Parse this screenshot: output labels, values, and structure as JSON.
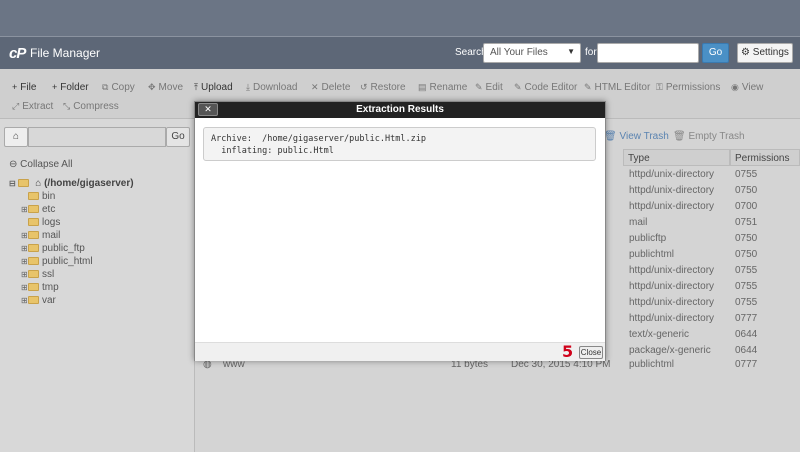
{
  "app": {
    "logo": "cP",
    "title": "File Manager"
  },
  "search": {
    "label": "Search",
    "scope": "All Your Files",
    "for_label": "for",
    "placeholder": "",
    "go": "Go",
    "settings": "Settings"
  },
  "toolbar": {
    "items": [
      {
        "icon": "+",
        "label": "File"
      },
      {
        "icon": "+",
        "label": "Folder"
      },
      {
        "icon": "⧉",
        "label": "Copy"
      },
      {
        "icon": "✥",
        "label": "Move"
      },
      {
        "icon": "⤒",
        "label": "Upload"
      },
      {
        "icon": "⤓",
        "label": "Download"
      },
      {
        "icon": "✕",
        "label": "Delete"
      },
      {
        "icon": "↺",
        "label": "Restore"
      },
      {
        "icon": "▤",
        "label": "Rename"
      },
      {
        "icon": "✎",
        "label": "Edit"
      },
      {
        "icon": "✎",
        "label": "Code Editor"
      },
      {
        "icon": "✎",
        "label": "HTML Editor"
      },
      {
        "icon": "⚿",
        "label": "Permissions"
      },
      {
        "icon": "◉",
        "label": "View"
      },
      {
        "icon": "⤢",
        "label": "Extract"
      },
      {
        "icon": "⤡",
        "label": "Compress"
      }
    ]
  },
  "sidebar": {
    "go": "Go",
    "collapse_all": "Collapse All",
    "root": "(/home/gigaserver)",
    "folders": [
      {
        "name": "bin",
        "expandable": false
      },
      {
        "name": "etc",
        "expandable": true
      },
      {
        "name": "logs",
        "expandable": false
      },
      {
        "name": "mail",
        "expandable": true
      },
      {
        "name": "public_ftp",
        "expandable": true
      },
      {
        "name": "public_html",
        "expandable": true
      },
      {
        "name": "ssl",
        "expandable": true
      },
      {
        "name": "tmp",
        "expandable": true
      },
      {
        "name": "var",
        "expandable": true
      }
    ]
  },
  "main": {
    "view_trash": "View Trash",
    "empty_trash": "Empty Trash",
    "columns": {
      "type": "Type",
      "permissions": "Permissions"
    },
    "rows": [
      {
        "type": "httpd/unix-directory",
        "perm": "0755"
      },
      {
        "type": "httpd/unix-directory",
        "perm": "0750"
      },
      {
        "type": "httpd/unix-directory",
        "perm": "0700"
      },
      {
        "type": "mail",
        "perm": "0751"
      },
      {
        "type": "publicftp",
        "perm": "0750"
      },
      {
        "type": "publichtml",
        "perm": "0750"
      },
      {
        "type": "httpd/unix-directory",
        "perm": "0755"
      },
      {
        "type": "httpd/unix-directory",
        "perm": "0755"
      },
      {
        "type": "httpd/unix-directory",
        "perm": "0755"
      },
      {
        "type": "httpd/unix-directory",
        "perm": "0777"
      },
      {
        "type": "text/x-generic",
        "perm": "0644"
      },
      {
        "type": "package/x-generic",
        "perm": "0644"
      }
    ],
    "visible_row": {
      "name": "www",
      "size": "11 bytes",
      "date": "Dec 30, 2015 4:10 PM",
      "type": "publichtml",
      "perm": "0777"
    }
  },
  "modal": {
    "title": "Extraction Results",
    "close_x": "✕",
    "line1": "Archive:  /home/gigaserver/public.Html.zip",
    "line2": "  inflating: public.Html",
    "step_marker": "5",
    "close": "Close"
  }
}
